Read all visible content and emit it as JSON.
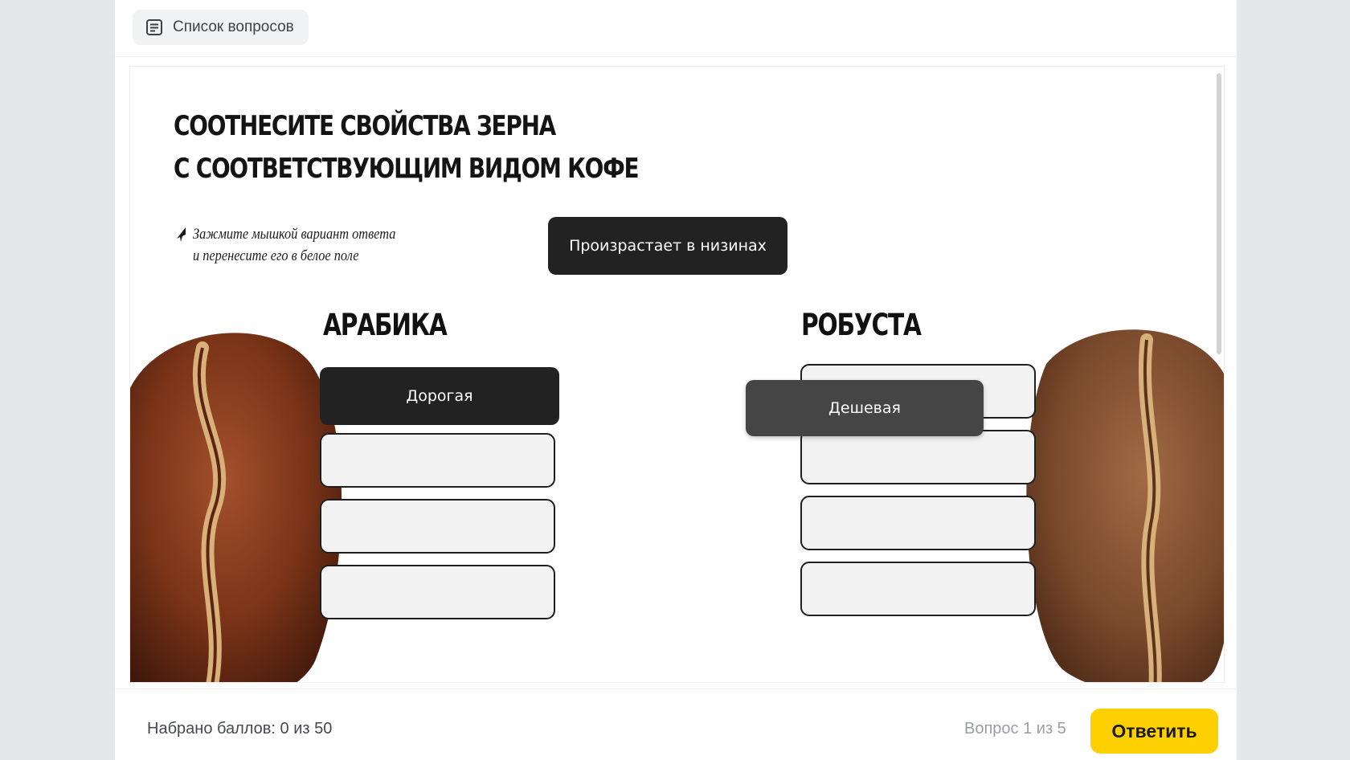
{
  "header": {
    "question_list_label": "Список вопросов",
    "question_list_icon": "list-document-icon"
  },
  "task": {
    "title_line1": "Соотнесите свойства зерна",
    "title_line2": "с соответствующим видом кофе",
    "hint": "Зажмите мышкой вариант ответа\nи перенесите его в белое поле",
    "hint_icon": "cursor-arrow-icon"
  },
  "chips": {
    "unplaced": "Произрастает в низинах",
    "arabica_placed": "Дорогая",
    "dragging": "Дешевая"
  },
  "columns": {
    "left_title": "Арабика",
    "right_title": "Робуста"
  },
  "footer": {
    "score": "Набрано баллов: 0 из 50",
    "question_counter": "Вопрос 1 из 5",
    "answer_label": "Ответить"
  },
  "colors": {
    "accent": "#ffd000",
    "chip_dark": "#222222",
    "chip_dragging": "#454545",
    "slot_fill": "#f2f2f2"
  }
}
